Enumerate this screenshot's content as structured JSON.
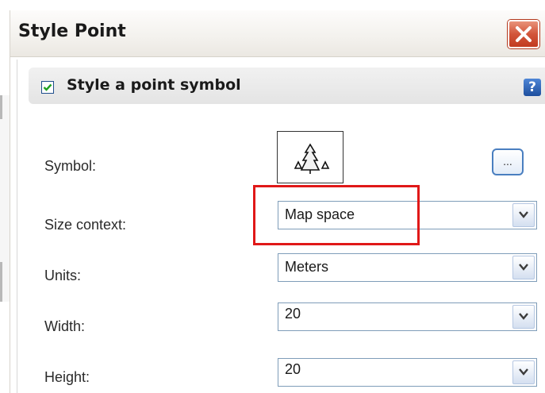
{
  "dialog": {
    "title": "Style Point",
    "close_icon": "close-icon"
  },
  "section": {
    "title": "Style a point symbol",
    "checked": true,
    "help_label": "?"
  },
  "fields": {
    "symbol": {
      "label": "Symbol:",
      "preview_icon": "trees-icon",
      "browse_label": "..."
    },
    "size_context": {
      "label": "Size context:",
      "value": "Map space"
    },
    "units": {
      "label": "Units:",
      "value": "Meters"
    },
    "width": {
      "label": "Width:",
      "value": "20"
    },
    "height": {
      "label": "Height:",
      "value": "20"
    }
  },
  "colors": {
    "highlight": "#e01818",
    "close_button": "#c23b20",
    "accent": "#4a7fc0"
  }
}
